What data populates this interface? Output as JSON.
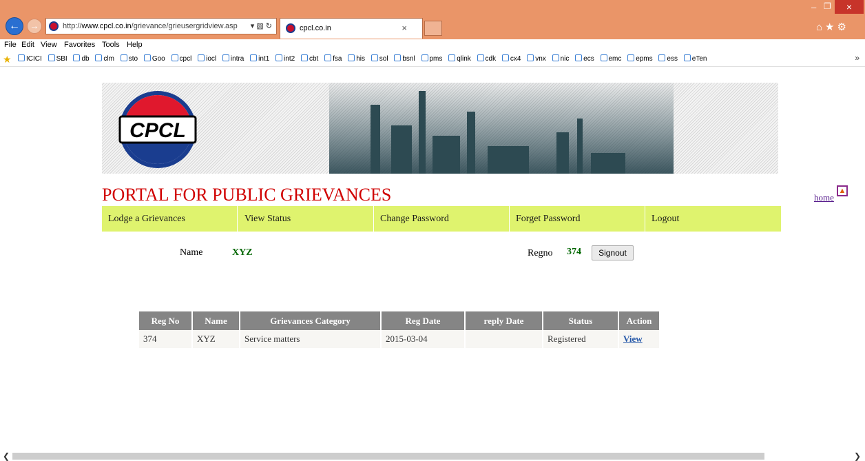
{
  "browser": {
    "url_prefix": "http://",
    "url_domain": "www.cpcl.co.in",
    "url_path": "/grievance/grieusergridview.asp",
    "tab_title": "cpcl.co.in",
    "menu": [
      "File",
      "Edit",
      "View",
      "Favorites",
      "Tools",
      "Help"
    ],
    "favorites": [
      "ICICI",
      "SBI",
      "db",
      "clm",
      "sto",
      "Goo",
      "cpcl",
      "iocl",
      "intra",
      "int1",
      "int2",
      "cbt",
      "fsa",
      "his",
      "sol",
      "bsnl",
      "pms",
      "qlink",
      "cdk",
      "cx4",
      "vnx",
      "nic",
      "ecs",
      "emc",
      "epms",
      "ess",
      "eTen"
    ]
  },
  "page": {
    "logo_text": "CPCL",
    "title": "PORTAL FOR PUBLIC GRIEVANCES",
    "home_link": "home",
    "menu": [
      "Lodge a Grievances",
      "View Status",
      "Change Password",
      "Forget Password",
      "Logout"
    ],
    "user": {
      "name_label": "Name",
      "name_value": "XYZ",
      "regno_label": "Regno",
      "regno_value": "374",
      "signout_label": "Signout"
    },
    "table": {
      "headers": [
        "Reg No",
        "Name",
        "Grievances Category",
        "Reg Date",
        "reply Date",
        "Status",
        "Action"
      ],
      "rows": [
        [
          "374",
          "XYZ",
          "Service matters",
          "2015-03-04",
          "",
          "Registered",
          "View"
        ]
      ]
    }
  },
  "colors": {
    "title_red": "#d00000",
    "menu_bg": "#dff36e",
    "value_green": "#006600",
    "chrome_orange": "#ea9568"
  }
}
